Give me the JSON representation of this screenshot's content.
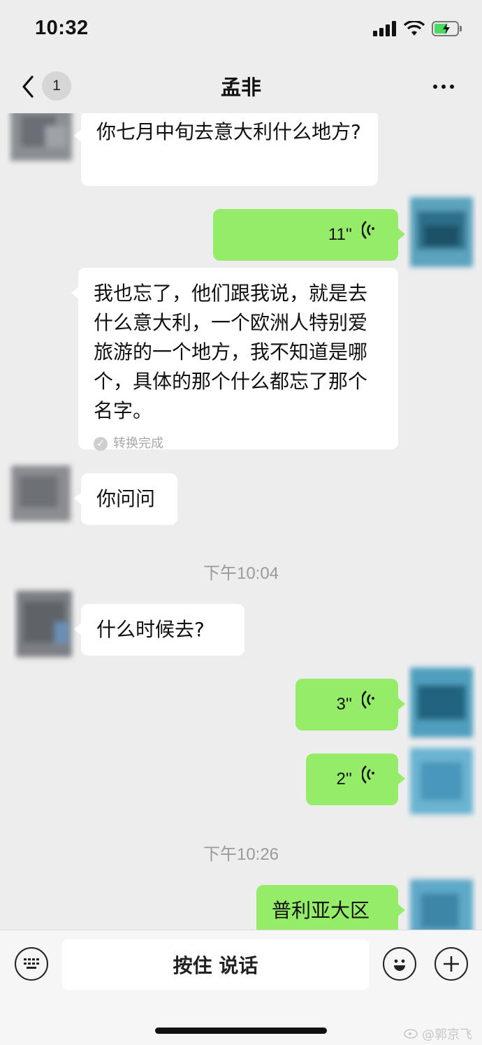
{
  "status_bar": {
    "time": "10:32"
  },
  "nav": {
    "unread_count": "1",
    "title": "孟非"
  },
  "messages": {
    "m1_text": "你七月中旬去意大利什么地方?",
    "m2_duration": "11''",
    "m3_text": "我也忘了，他们跟我说，就是去什么意大利，一个欧洲人特别爱旅游的一个地方，我不知道是哪个，具体的那个什么都忘了那个名字。",
    "m3_status": "转换完成",
    "m4_text": "你问问",
    "ts1": "下午10:04",
    "m5_text": "什么时候去?",
    "m6_duration": "3''",
    "m7_duration": "2''",
    "ts2": "下午10:26",
    "m8_text": "普利亚大区"
  },
  "input_bar": {
    "hold_to_talk": "按住 说话"
  },
  "watermark": {
    "text": "@郭京飞"
  },
  "colors": {
    "bg": "#ededed",
    "sent_bubble": "#95ec69",
    "received_bubble": "#ffffff"
  }
}
